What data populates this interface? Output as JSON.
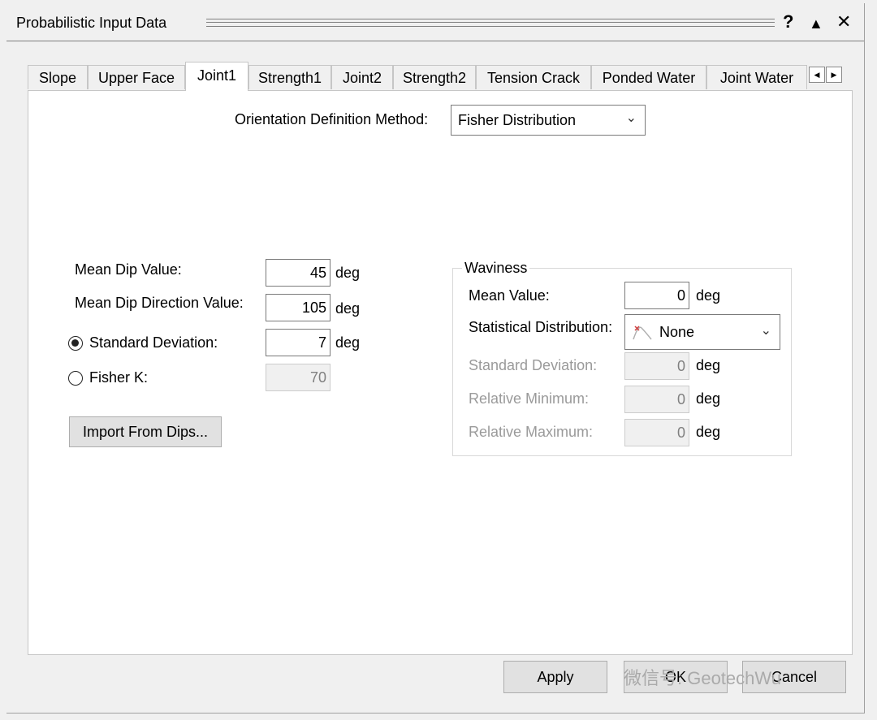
{
  "window": {
    "title": "Probabilistic Input Data",
    "help_label": "?",
    "collapse_label": "▲",
    "close_label": "✕"
  },
  "tabs": [
    {
      "label": "Slope",
      "active": false
    },
    {
      "label": "Upper Face",
      "active": false
    },
    {
      "label": "Joint1",
      "active": true
    },
    {
      "label": "Strength1",
      "active": false
    },
    {
      "label": "Joint2",
      "active": false
    },
    {
      "label": "Strength2",
      "active": false
    },
    {
      "label": "Tension Crack",
      "active": false
    },
    {
      "label": "Ponded Water",
      "active": false
    },
    {
      "label": "Joint Water",
      "active": false
    }
  ],
  "tab_scroll": {
    "left": "◀",
    "right": "▶"
  },
  "orientation": {
    "label": "Orientation Definition Method:",
    "value": "Fisher Distribution"
  },
  "joint": {
    "mean_dip_label": "Mean Dip Value:",
    "mean_dip_value": "45",
    "mean_dip_dir_label": "Mean Dip Direction Value:",
    "mean_dip_dir_value": "105",
    "std_dev_label": "Standard Deviation:",
    "std_dev_value": "7",
    "fisher_k_label": "Fisher K:",
    "fisher_k_value": "70",
    "unit": "deg",
    "import_button": "Import From Dips..."
  },
  "waviness": {
    "title": "Waviness",
    "mean_label": "Mean Value:",
    "mean_value": "0",
    "dist_label": "Statistical Distribution:",
    "dist_value": "None",
    "std_label": "Standard Deviation:",
    "std_value": "0",
    "rel_min_label": "Relative Minimum:",
    "rel_min_value": "0",
    "rel_max_label": "Relative Maximum:",
    "rel_max_value": "0",
    "unit": "deg"
  },
  "footer": {
    "apply": "Apply",
    "ok": "OK",
    "cancel": "Cancel"
  },
  "watermark": "微信号: GeotechWu",
  "colors": {
    "window_bg": "#f0f0f0",
    "panel_bg": "#ffffff",
    "disabled_text": "#9a9a9a",
    "border": "#7a7a7a"
  }
}
